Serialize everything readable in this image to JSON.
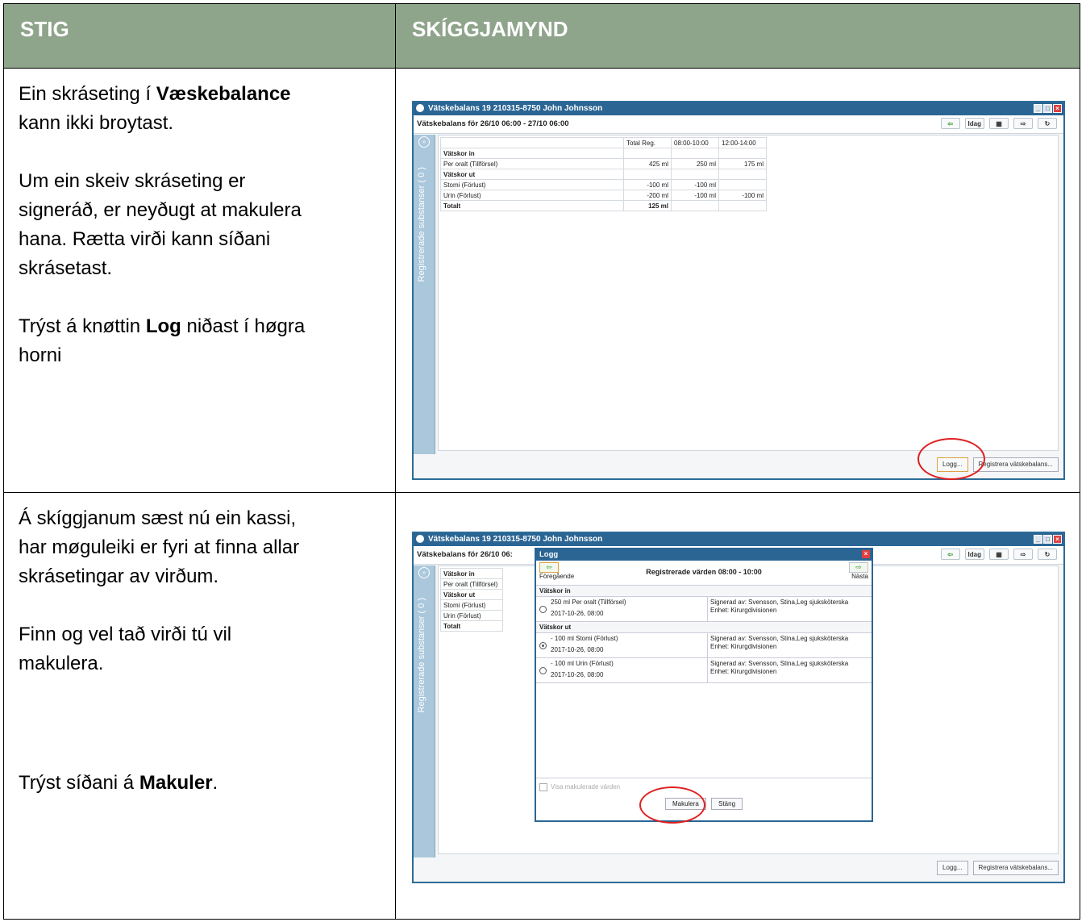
{
  "headers": {
    "step": "STIG",
    "screenshot": "SKÍGGJAMYND"
  },
  "row1": {
    "p1_pre": "Ein skráseting í ",
    "p1_bold": "Væskebalance",
    "p1_post": "\nkann ikki broytast.",
    "p2": "Um ein skeiv skráseting er\nsigneráð, er neyðugt at makulera\nhana. Rætta virði kann síðani\nskrásetast.",
    "p3_pre": "Trýst á knøttin ",
    "p3_bold": "Log",
    "p3_post": " niðast í høgra\nhorni"
  },
  "row2": {
    "p1": "Á skíggjanum sæst nú ein kassi,\nhar møguleiki er fyri at finna allar\nskrásetingar av virðum.",
    "p2": "Finn og vel tað virði tú vil\nmakulera.",
    "p3_pre": "Trýst síðani á ",
    "p3_bold": "Makuler",
    "p3_post": "."
  },
  "app": {
    "title": "Vätskebalans 19 210315-8750 John Johnsson",
    "subtitle": "Vätskebalans för 26/10 06:00 - 27/10 06:00",
    "subtitle_short": "Vätskebalans för 26/10 06:",
    "today_label": "Idag",
    "side_tab": "Registrerade substanser ( 0 )",
    "log_button": "Logg...",
    "register_button": "Registrera vätskebalans...",
    "table": {
      "headers": [
        "",
        "Total Reg.",
        "08:00-10:00",
        "12:00-14:00"
      ],
      "rows": [
        {
          "label": "Vätskor in",
          "group": true,
          "cells": [
            "",
            "",
            ""
          ]
        },
        {
          "label": "Per oralt (Tillförsel)",
          "group": false,
          "cells": [
            "425 ml",
            "250 ml",
            "175 ml"
          ]
        },
        {
          "label": "Vätskor ut",
          "group": true,
          "cells": [
            "",
            "",
            ""
          ]
        },
        {
          "label": "Stomi (Förlust)",
          "group": false,
          "cells": [
            "-100 ml",
            "-100 ml",
            ""
          ]
        },
        {
          "label": "Urin (Förlust)",
          "group": false,
          "cells": [
            "-200 ml",
            "-100 ml",
            "-100 ml"
          ]
        },
        {
          "label": "Totalt",
          "group": true,
          "cells": [
            "125 ml",
            "",
            ""
          ]
        }
      ]
    }
  },
  "dialog": {
    "title": "Logg",
    "prev": "Föregående",
    "next": "Nästa",
    "heading": "Registrerade värden 08:00 - 10:00",
    "group_in": "Vätskor in",
    "group_out": "Vätskor ut",
    "entries": [
      {
        "l1": "250 ml Per oralt (Tillförsel)",
        "l2": "2017-10-26, 08:00",
        "r1": "Signerad av: Svensson, Stina,Leg sjuksköterska",
        "r2": "Enhet:      Kirurgdivisionen"
      },
      {
        "l1": "- 100 ml Stomi (Förlust)",
        "l2": "2017-10-26, 08:00",
        "r1": "Signerad av: Svensson, Stina,Leg sjuksköterska",
        "r2": "Enhet:      Kirurgdivisionen"
      },
      {
        "l1": "- 100 ml Urin (Förlust)",
        "l2": "2017-10-26, 08:00",
        "r1": "Signerad av: Svensson, Stina,Leg sjuksköterska",
        "r2": "Enhet:      Kirurgdivisionen"
      }
    ],
    "show_cancelled": "Visa makulerade värden",
    "cancel_button": "Makulera",
    "close_button": "Stäng"
  }
}
